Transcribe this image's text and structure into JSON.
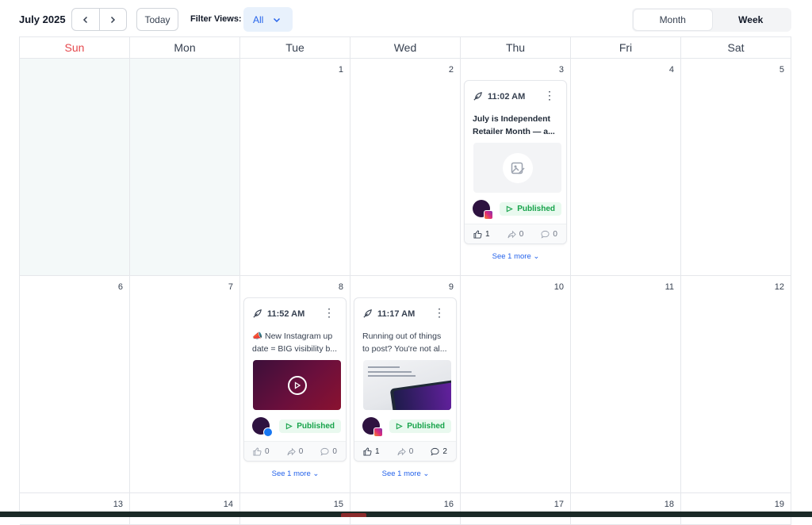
{
  "header": {
    "month_label": "July 2025",
    "prev_icon": "chevron-left-icon",
    "next_icon": "chevron-right-icon",
    "today_label": "Today",
    "filter_label": "Filter Views:",
    "filter_value": "All",
    "view_month": "Month",
    "view_week": "Week"
  },
  "weekdays": [
    "Sun",
    "Mon",
    "Tue",
    "Wed",
    "Thu",
    "Fri",
    "Sat"
  ],
  "weeks": [
    [
      "",
      "",
      "1",
      "2",
      "3",
      "4",
      "5"
    ],
    [
      "6",
      "7",
      "8",
      "9",
      "10",
      "11",
      "12"
    ],
    [
      "13",
      "14",
      "15",
      "16",
      "17",
      "18",
      "19"
    ]
  ],
  "posts": {
    "thu3": {
      "time": "11:02 AM",
      "line1": "July is Independent",
      "line2": "Retailer Month — a...",
      "status": "Published",
      "network": "instagram",
      "likes": "1",
      "shares": "0",
      "comments": "0",
      "see_more": "See 1 more"
    },
    "tue8": {
      "time": "11:52 AM",
      "line1": "📣 New Instagram up",
      "line2": "date = BIG visibility b...",
      "status": "Published",
      "network": "facebook",
      "likes": "0",
      "shares": "0",
      "comments": "0",
      "see_more": "See 1 more"
    },
    "wed9": {
      "time": "11:17 AM",
      "line1": "Running out of things",
      "line2": "to post? You're not al...",
      "status": "Published",
      "network": "instagram",
      "likes": "1",
      "shares": "0",
      "comments": "2",
      "see_more": "See 1 more"
    }
  },
  "colors": {
    "accent": "#2563eb",
    "sunday": "#e5484d",
    "published_bg": "#e9f9ef",
    "published_text": "#16a34a",
    "past_day_bg": "#f4f9f9"
  }
}
